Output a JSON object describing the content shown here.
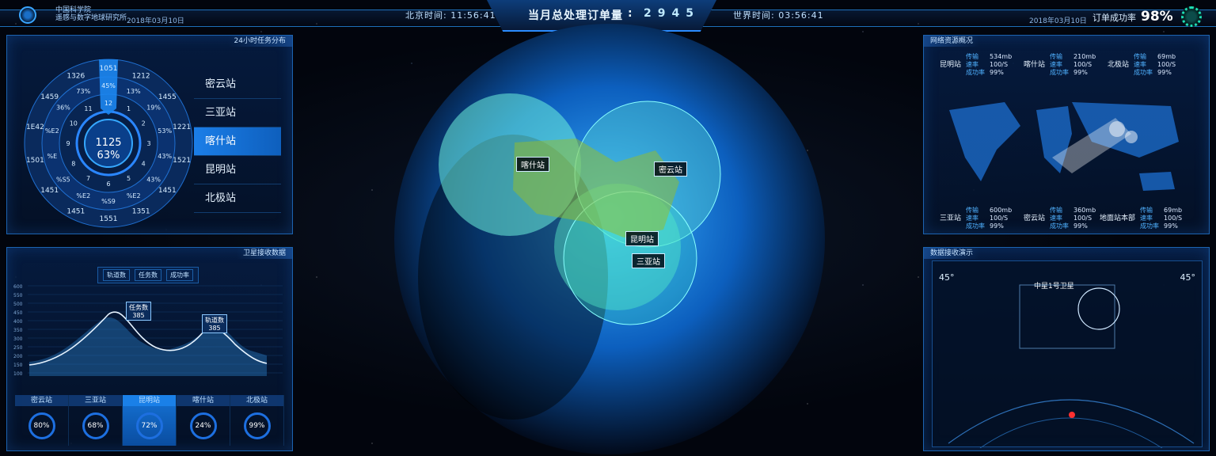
{
  "header": {
    "org_line1": "中国科学院",
    "org_line2": "遥感与数字地球研究所",
    "date_left": "2018年03月10日",
    "date_right": "2018年03月10日",
    "beijing_time": "北京时间: 11:56:41",
    "world_time": "世界时间: 03:56:41",
    "center_label": "当月总处理订单量",
    "center_sep": ":",
    "center_value": "2945",
    "order_rate_label": "订单成功率",
    "order_rate_value": "98%"
  },
  "task_panel": {
    "title": "24小时任务分布",
    "center_value": "1125",
    "center_pct": "63%",
    "outer_ring": [
      "1051",
      "1212",
      "1455",
      "1221",
      "1521",
      "1451",
      "1351",
      "1551",
      "1451",
      "1451",
      "1501",
      "1E42",
      "1459",
      "1326"
    ],
    "mid_ring": [
      "45%",
      "13%",
      "19%",
      "53%",
      "43%",
      "43%",
      "%E2",
      "%S9",
      "%E2",
      "%S5",
      "%E",
      "%E2",
      "36%",
      "73%"
    ],
    "inner_ring": [
      "12",
      "1",
      "2",
      "3",
      "4",
      "5",
      "6",
      "7",
      "8",
      "9",
      "10",
      "11"
    ],
    "stations": [
      "密云站",
      "三亚站",
      "喀什站",
      "昆明站",
      "北极站"
    ],
    "active_station": "喀什站"
  },
  "sat_panel": {
    "title": "卫星接收数据",
    "legend": [
      "轨道数",
      "任务数",
      "成功率"
    ],
    "yticks": [
      "600",
      "550",
      "500",
      "450",
      "400",
      "350",
      "300",
      "250",
      "200",
      "150",
      "100"
    ],
    "callout1_label": "任务数",
    "callout1_value": "385",
    "callout2_label": "轨道数",
    "callout2_value": "385",
    "cards": [
      {
        "name": "密云站",
        "pct": "80%"
      },
      {
        "name": "三亚站",
        "pct": "68%"
      },
      {
        "name": "昆明站",
        "pct": "72%"
      },
      {
        "name": "喀什站",
        "pct": "24%"
      },
      {
        "name": "北极站",
        "pct": "99%"
      }
    ],
    "active_card": "昆明站"
  },
  "net_panel": {
    "title": "网络资源概况",
    "keys": [
      "传输",
      "速率",
      "成功率"
    ],
    "top": [
      {
        "name": "昆明站",
        "v": [
          "534mb",
          "100/S",
          "99%"
        ]
      },
      {
        "name": "喀什站",
        "v": [
          "210mb",
          "100/S",
          "99%"
        ]
      },
      {
        "name": "北极站",
        "v": [
          "69mb",
          "100/S",
          "99%"
        ]
      }
    ],
    "bottom": [
      {
        "name": "三亚站",
        "v": [
          "600mb",
          "100/S",
          "99%"
        ]
      },
      {
        "name": "密云站",
        "v": [
          "360mb",
          "100/S",
          "99%"
        ]
      },
      {
        "name": "地面站本部",
        "v": [
          "69mb",
          "100/S",
          "99%"
        ]
      }
    ]
  },
  "demo_panel": {
    "title": "数据接收演示",
    "sat_name": "中星1号卫星",
    "deg_left": "45°",
    "deg_right": "45°"
  },
  "globe": {
    "labels": [
      "喀什站",
      "密云站",
      "昆明站",
      "三亚站"
    ]
  }
}
